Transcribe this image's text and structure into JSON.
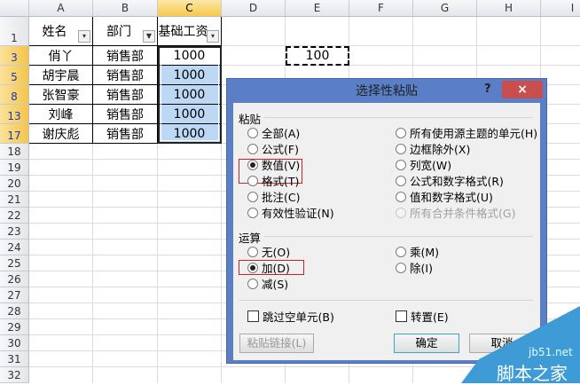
{
  "columns": [
    "A",
    "B",
    "C",
    "D",
    "E",
    "F",
    "G",
    "H",
    "I"
  ],
  "rows": [
    "1",
    "3",
    "5",
    "8",
    "13",
    "17",
    "18",
    "19",
    "20",
    "21",
    "22",
    "23",
    "24",
    "25",
    "26",
    "27",
    "28",
    "29",
    "30",
    "31",
    "32"
  ],
  "table": {
    "headers": [
      "姓名",
      "部门",
      "基础工资"
    ],
    "data": [
      [
        "俏丫",
        "销售部",
        "1000"
      ],
      [
        "胡宇晨",
        "销售部",
        "1000"
      ],
      [
        "张智豪",
        "销售部",
        "1000"
      ],
      [
        "刘峰",
        "销售部",
        "1000"
      ],
      [
        "谢庆彪",
        "销售部",
        "1000"
      ]
    ]
  },
  "copied_cell_value": "100",
  "dialog": {
    "title": "选择性粘贴",
    "help": "?",
    "close": "×",
    "paste_section": "粘贴",
    "paste_options_left": [
      {
        "label": "全部(A)",
        "checked": false
      },
      {
        "label": "公式(F)",
        "checked": false
      },
      {
        "label": "数值(V)",
        "checked": true
      },
      {
        "label": "格式(T)",
        "checked": false
      },
      {
        "label": "批注(C)",
        "checked": false
      },
      {
        "label": "有效性验证(N)",
        "checked": false
      }
    ],
    "paste_options_right": [
      {
        "label": "所有使用源主题的单元(H)",
        "checked": false
      },
      {
        "label": "边框除外(X)",
        "checked": false
      },
      {
        "label": "列宽(W)",
        "checked": false
      },
      {
        "label": "公式和数字格式(R)",
        "checked": false
      },
      {
        "label": "值和数字格式(U)",
        "checked": false
      },
      {
        "label": "所有合并条件格式(G)",
        "checked": false,
        "disabled": true
      }
    ],
    "operation_section": "运算",
    "operation_left": [
      {
        "label": "无(O)",
        "checked": false
      },
      {
        "label": "加(D)",
        "checked": true
      },
      {
        "label": "减(S)",
        "checked": false
      }
    ],
    "operation_right": [
      {
        "label": "乘(M)",
        "checked": false
      },
      {
        "label": "除(I)",
        "checked": false
      }
    ],
    "skip_blanks": "跳过空单元(B)",
    "transpose": "转置(E)",
    "paste_link": "粘贴链接(L)",
    "ok": "确定",
    "cancel": "取消"
  },
  "watermark": {
    "site": "jb51.net",
    "name": "脚本之家"
  },
  "colors": {
    "accent": "#5b7fc6",
    "selection": "#bcd8f4",
    "highlight": "#d02020"
  }
}
